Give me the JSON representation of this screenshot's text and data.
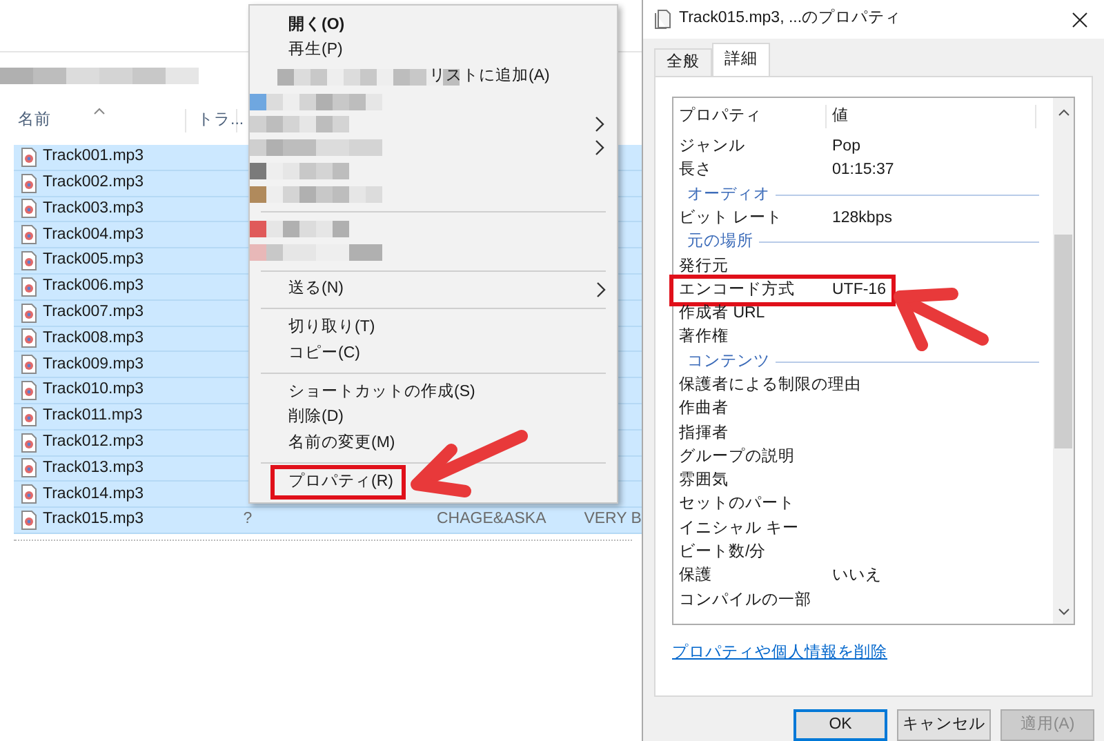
{
  "explorer": {
    "columns": [
      {
        "label": "名前",
        "sorted": true
      },
      {
        "label": "トラ..."
      }
    ],
    "rows": [
      {
        "name": "Track001.mp3",
        "selected": true
      },
      {
        "name": "Track002.mp3",
        "selected": true
      },
      {
        "name": "Track003.mp3",
        "selected": true
      },
      {
        "name": "Track004.mp3",
        "selected": true
      },
      {
        "name": "Track005.mp3",
        "selected": true
      },
      {
        "name": "Track006.mp3",
        "selected": true
      },
      {
        "name": "Track007.mp3",
        "selected": true
      },
      {
        "name": "Track008.mp3",
        "selected": true
      },
      {
        "name": "Track009.mp3",
        "selected": true
      },
      {
        "name": "Track010.mp3",
        "selected": true
      },
      {
        "name": "Track011.mp3",
        "selected": true
      },
      {
        "name": "Track012.mp3",
        "selected": true
      },
      {
        "name": "Track013.mp3",
        "selected": true
      },
      {
        "name": "Track014.mp3",
        "selected": true
      },
      {
        "name": "Track015.mp3",
        "selected": true,
        "cells": [
          "?",
          "CHAGE&ASKA",
          "VERY B"
        ]
      }
    ]
  },
  "context_menu": {
    "items": [
      {
        "kind": "item",
        "label": "開く(O)",
        "bold": true,
        "submenu": false,
        "highlighted": false
      },
      {
        "kind": "item",
        "label": "再生(P)",
        "bold": false,
        "submenu": false,
        "highlighted": false
      },
      {
        "kind": "partial",
        "label": "リストに追加(A)"
      },
      {
        "kind": "blurred",
        "submenu": false
      },
      {
        "kind": "blurred",
        "submenu": true
      },
      {
        "kind": "blurred",
        "submenu": true
      },
      {
        "kind": "blurred",
        "submenu": false
      },
      {
        "kind": "blurred",
        "submenu": false
      },
      {
        "kind": "separator"
      },
      {
        "kind": "blurred",
        "submenu": false
      },
      {
        "kind": "blurred",
        "submenu": false
      },
      {
        "kind": "separator"
      },
      {
        "kind": "item",
        "label": "送る(N)",
        "bold": false,
        "submenu": true,
        "highlighted": false
      },
      {
        "kind": "separator"
      },
      {
        "kind": "item",
        "label": "切り取り(T)",
        "bold": false,
        "submenu": false,
        "highlighted": false
      },
      {
        "kind": "item",
        "label": "コピー(C)",
        "bold": false,
        "submenu": false,
        "highlighted": false
      },
      {
        "kind": "separator"
      },
      {
        "kind": "item",
        "label": "ショートカットの作成(S)",
        "bold": false,
        "submenu": false,
        "highlighted": false
      },
      {
        "kind": "item",
        "label": "削除(D)",
        "bold": false,
        "submenu": false,
        "highlighted": false
      },
      {
        "kind": "item",
        "label": "名前の変更(M)",
        "bold": false,
        "submenu": false,
        "highlighted": false
      },
      {
        "kind": "separator"
      },
      {
        "kind": "item",
        "label": "プロパティ(R)",
        "bold": false,
        "submenu": false,
        "highlighted": true
      }
    ]
  },
  "dialog": {
    "title": "Track015.mp3, ...のプロパティ",
    "tabs": [
      {
        "label": "全般",
        "selected": false
      },
      {
        "label": "詳細",
        "selected": true
      }
    ],
    "columns": [
      "プロパティ",
      "値"
    ],
    "rows": [
      {
        "kind": "row",
        "name": "ジャンル",
        "value": "Pop",
        "highlighted": false
      },
      {
        "kind": "row",
        "name": "長さ",
        "value": "01:15:37",
        "highlighted": false
      },
      {
        "kind": "group",
        "name": "オーディオ"
      },
      {
        "kind": "row",
        "name": "ビット レート",
        "value": "128kbps",
        "highlighted": false
      },
      {
        "kind": "group",
        "name": "元の場所"
      },
      {
        "kind": "row",
        "name": "発行元",
        "highlighted": false
      },
      {
        "kind": "row",
        "name": "エンコード方式",
        "value": "UTF-16",
        "highlighted": true
      },
      {
        "kind": "row",
        "name": "作成者 URL",
        "highlighted": false
      },
      {
        "kind": "row",
        "name": "著作権",
        "highlighted": false
      },
      {
        "kind": "group",
        "name": "コンテンツ"
      },
      {
        "kind": "row",
        "name": "保護者による制限の理由",
        "highlighted": false
      },
      {
        "kind": "row",
        "name": "作曲者",
        "highlighted": false
      },
      {
        "kind": "row",
        "name": "指揮者",
        "highlighted": false
      },
      {
        "kind": "row",
        "name": "グループの説明",
        "highlighted": false
      },
      {
        "kind": "row",
        "name": "雰囲気",
        "highlighted": false
      },
      {
        "kind": "row",
        "name": "セットのパート",
        "highlighted": false
      },
      {
        "kind": "row",
        "name": "イニシャル キー",
        "highlighted": false
      },
      {
        "kind": "row",
        "name": "ビート数/分",
        "highlighted": false
      },
      {
        "kind": "row",
        "name": "保護",
        "value": "いいえ",
        "highlighted": false
      },
      {
        "kind": "row",
        "name": "コンパイルの一部",
        "highlighted": false
      }
    ],
    "link": "プロパティや個人情報を削除",
    "buttons": [
      {
        "label": "OK",
        "default": true,
        "disabled": false
      },
      {
        "label": "キャンセル",
        "default": false,
        "disabled": false
      },
      {
        "label": "適用(A)",
        "default": false,
        "disabled": true
      }
    ]
  }
}
